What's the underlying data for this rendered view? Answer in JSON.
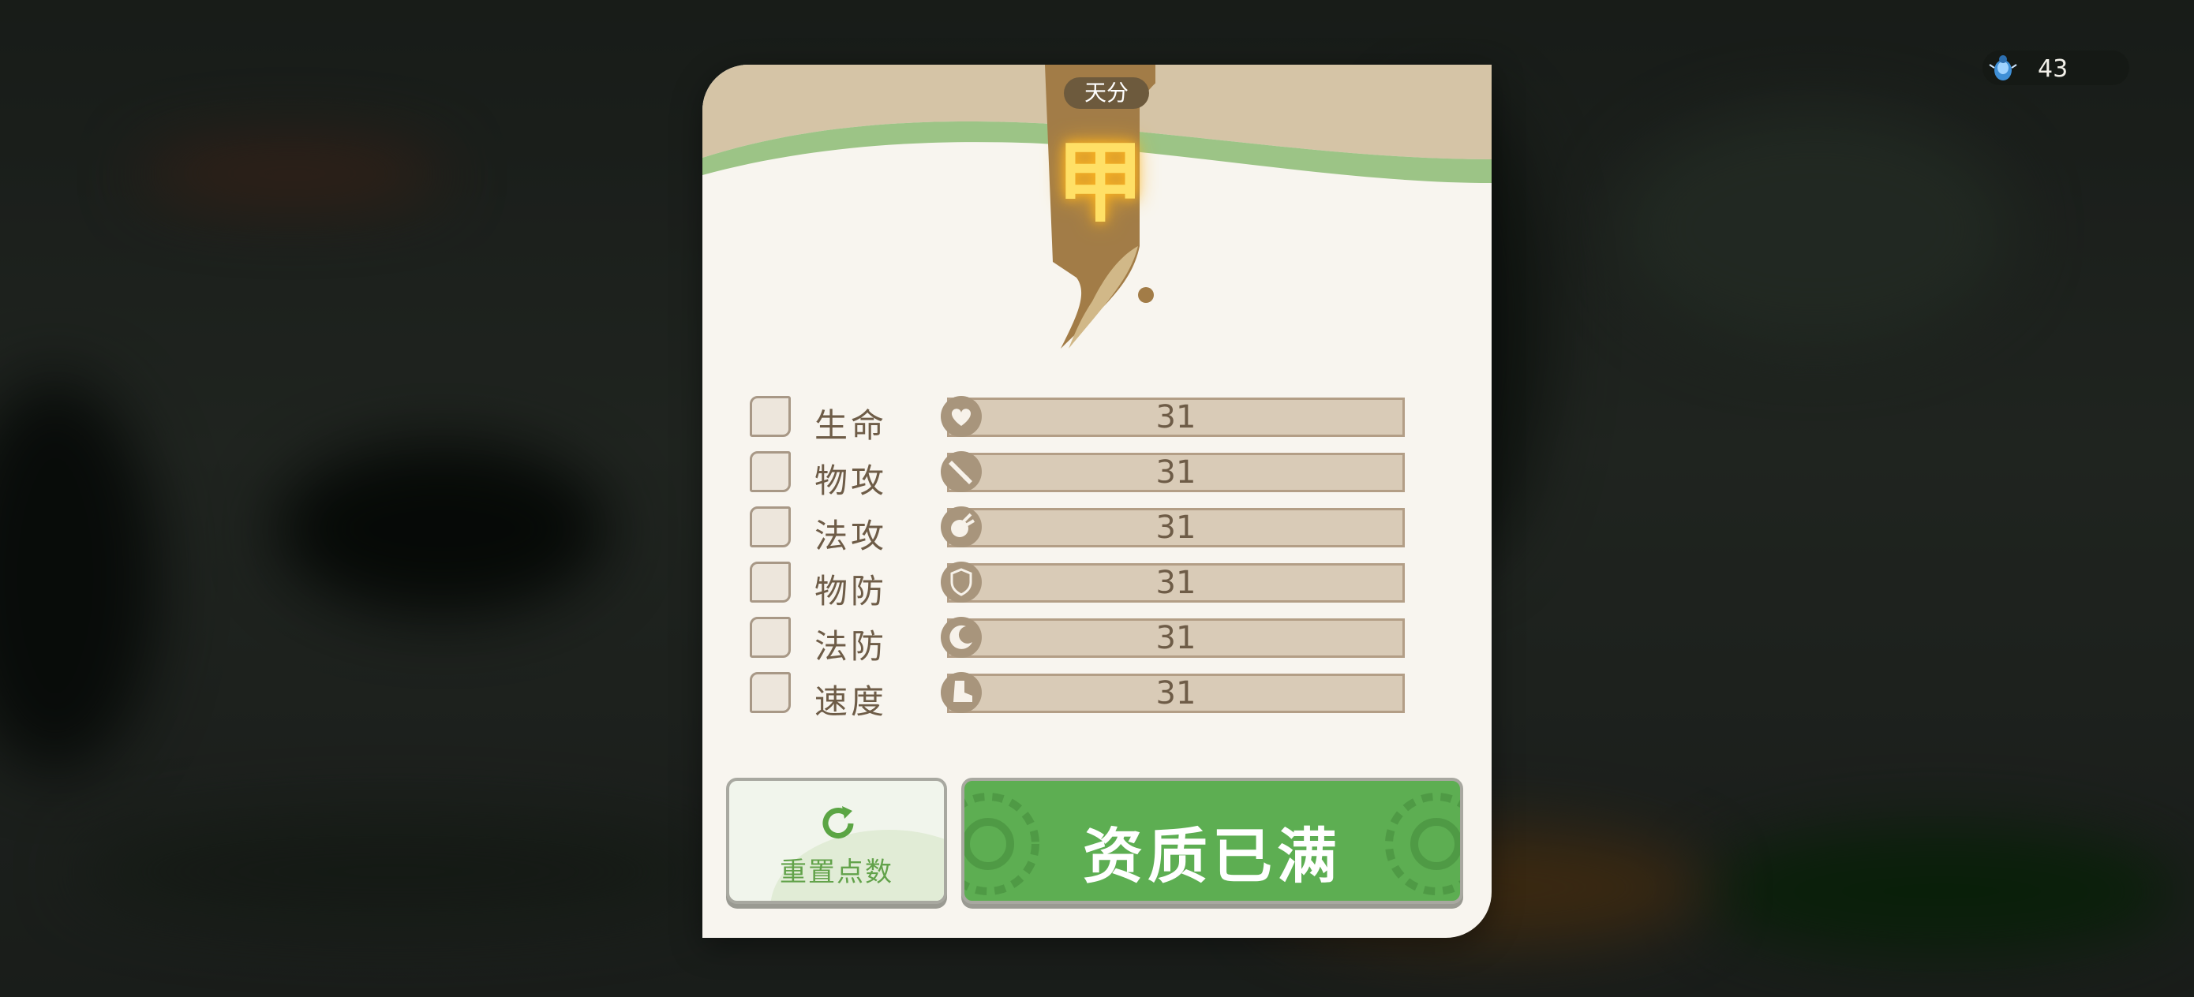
{
  "currency": {
    "icon": "beetle-gem-icon",
    "amount": "43"
  },
  "panel": {
    "tag_label": "天分",
    "grade": "甲",
    "stats": [
      {
        "label": "生命",
        "icon": "heart-icon",
        "value": "31"
      },
      {
        "label": "物攻",
        "icon": "sword-icon",
        "value": "31"
      },
      {
        "label": "法攻",
        "icon": "magic-orb-icon",
        "value": "31"
      },
      {
        "label": "物防",
        "icon": "shield-icon",
        "value": "31"
      },
      {
        "label": "法防",
        "icon": "moon-shield-icon",
        "value": "31"
      },
      {
        "label": "速度",
        "icon": "boot-icon",
        "value": "31"
      }
    ],
    "reset_button": "重置点数",
    "full_button": "资质已满"
  },
  "colors": {
    "accent_green": "#5dae52",
    "brown": "#6e5c47",
    "grade_gold": "#ffe066"
  }
}
